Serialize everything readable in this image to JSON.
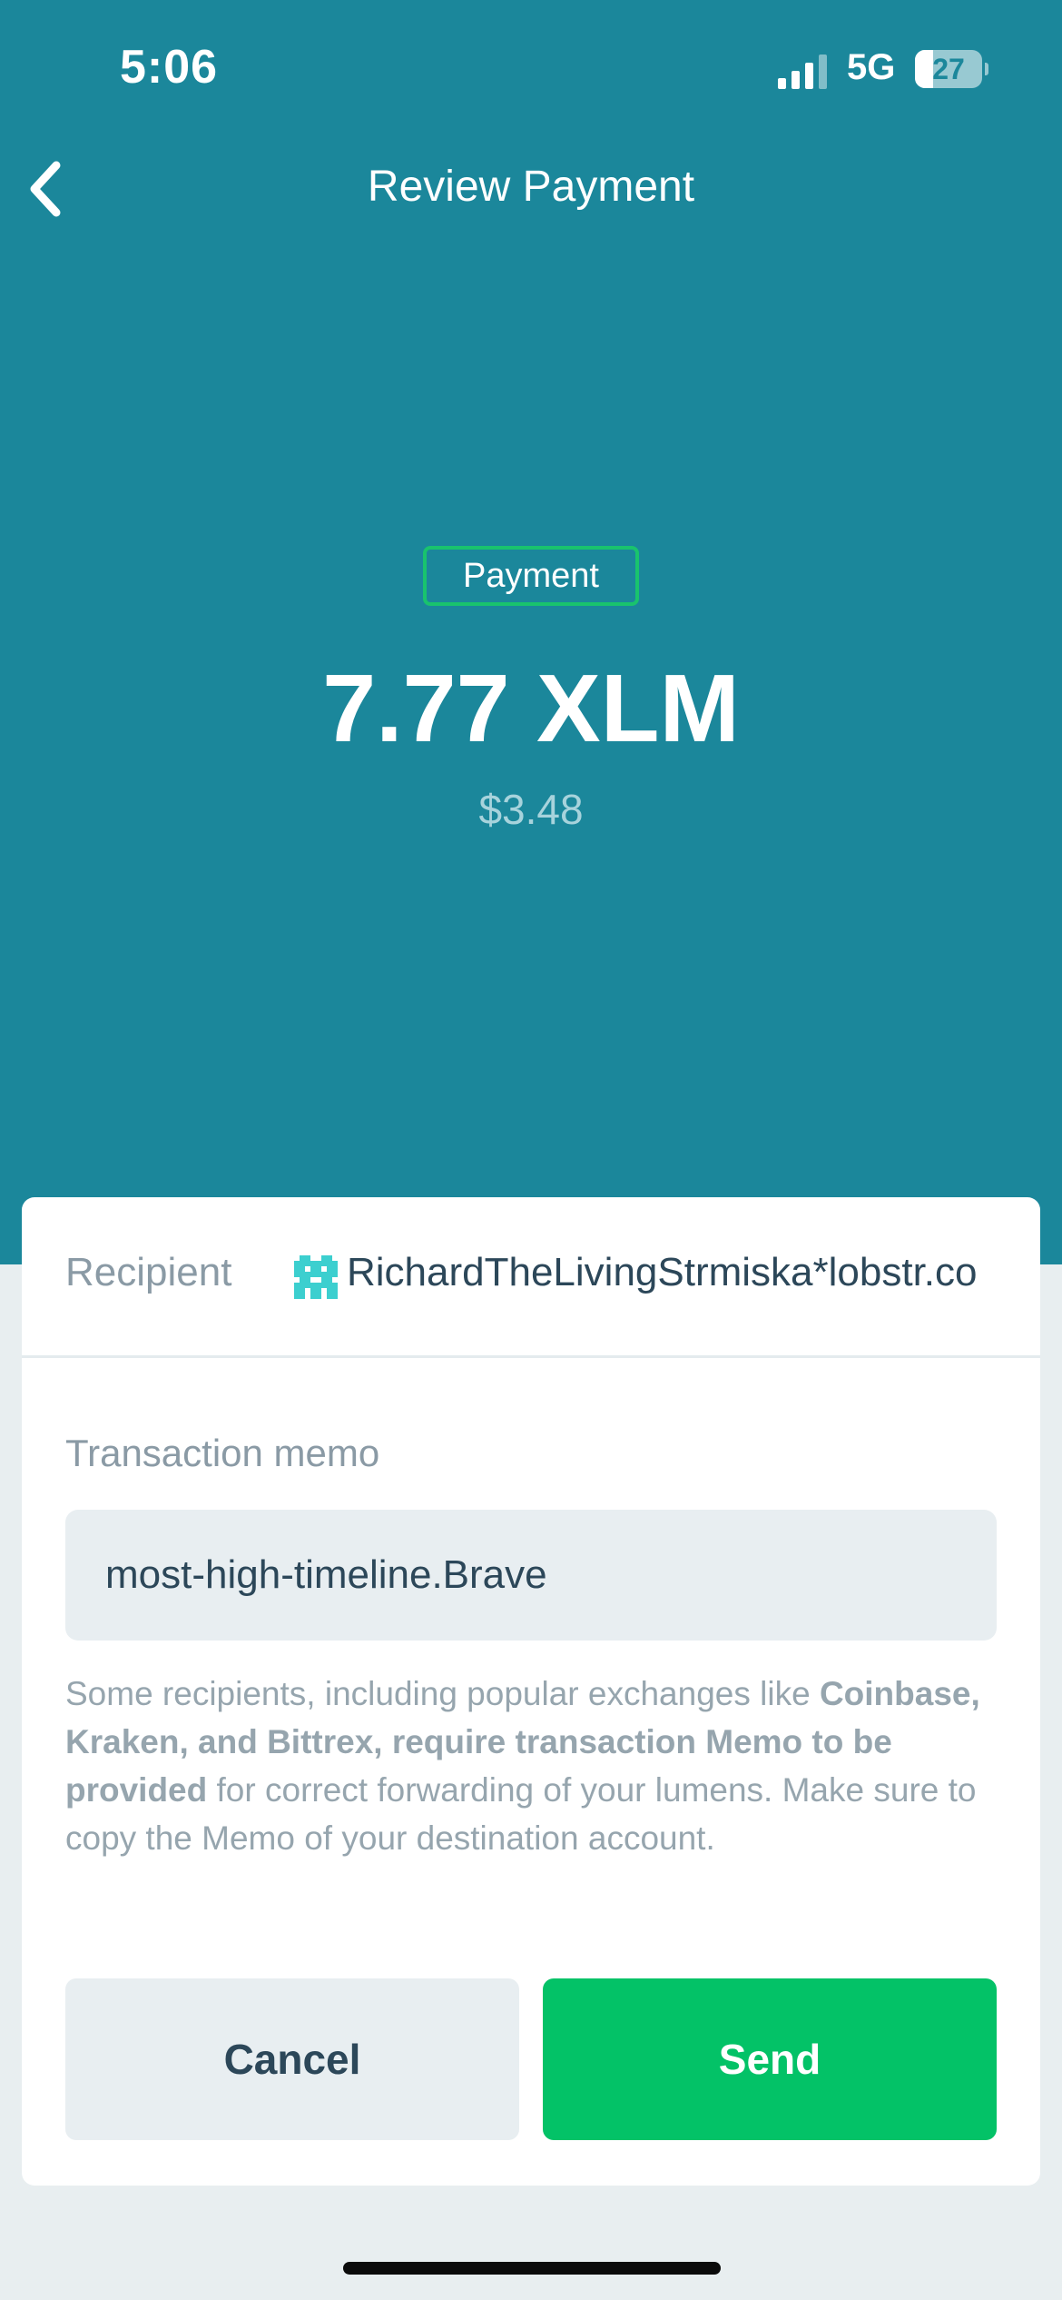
{
  "status_bar": {
    "time": "5:06",
    "network": "5G",
    "battery_level": 27,
    "battery_text": "27",
    "signal_bars_active": 3,
    "signal_bars_total": 4
  },
  "nav": {
    "title": "Review Payment",
    "back_icon": "chevron-left-icon"
  },
  "payment": {
    "type_label": "Payment",
    "amount": "7.77 XLM",
    "fiat_value": "$3.48"
  },
  "recipient": {
    "label": "Recipient",
    "address": "RichardTheLivingStrmiska*lobstr.co",
    "avatar_icon": "identicon-icon"
  },
  "memo": {
    "label": "Transaction memo",
    "value": "most-high-timeline.Brave",
    "hint_part1": "Some recipients, including popular exchanges like ",
    "hint_bold": "Coinbase, Kraken, and Bittrex, require transaction Memo to be provided",
    "hint_part2": " for correct forwarding of your lumens. Make sure to copy the Memo of your destination account."
  },
  "actions": {
    "cancel_label": "Cancel",
    "send_label": "Send"
  },
  "colors": {
    "header_bg": "#1b879b",
    "accent_green": "#03c267",
    "badge_border": "#19c36d",
    "text_dark": "#2c4759",
    "text_muted": "#8a9aa5",
    "page_bg": "#e8eef0"
  }
}
